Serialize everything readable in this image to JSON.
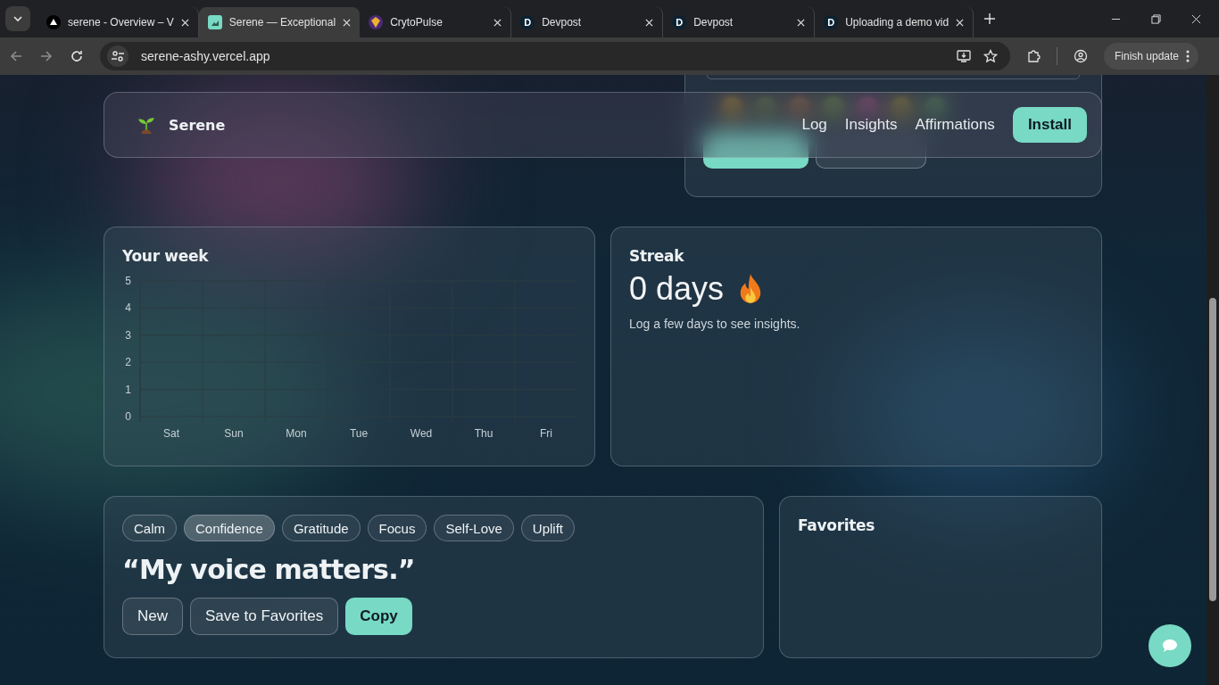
{
  "browser": {
    "tabs": [
      {
        "title": "serene - Overview – V",
        "kind": "triangle",
        "selected": false
      },
      {
        "title": "Serene — Exceptional",
        "kind": "app",
        "selected": true
      },
      {
        "title": "CrytoPulse",
        "kind": "gem",
        "selected": false
      },
      {
        "title": "Devpost",
        "kind": "letter",
        "icon_text": "D",
        "selected": false
      },
      {
        "title": "Devpost",
        "kind": "letter",
        "icon_text": "D",
        "selected": false
      },
      {
        "title": "Uploading a demo vid",
        "kind": "letter",
        "icon_text": "D",
        "selected": false
      }
    ],
    "address": "serene-ashy.vercel.app",
    "update_button": "Finish update"
  },
  "navbar": {
    "brand": "Serene",
    "links": [
      "Log",
      "Insights",
      "Affirmations"
    ],
    "install": "Install"
  },
  "week": {
    "title": "Your week",
    "chart_data": {
      "type": "bar",
      "categories": [
        "Sat",
        "Sun",
        "Mon",
        "Tue",
        "Wed",
        "Thu",
        "Fri"
      ],
      "values": [
        null,
        null,
        null,
        null,
        null,
        null,
        null
      ],
      "ylim": [
        0,
        5
      ],
      "grid": true,
      "yticks": [
        0,
        1,
        2,
        3,
        4,
        5
      ]
    }
  },
  "streak": {
    "title": "Streak",
    "value": "0 days",
    "note": "Log a few days to see insights."
  },
  "affirmations": {
    "categories": [
      {
        "label": "Calm",
        "selected": false
      },
      {
        "label": "Confidence",
        "selected": true
      },
      {
        "label": "Gratitude",
        "selected": false
      },
      {
        "label": "Focus",
        "selected": false
      },
      {
        "label": "Self-Love",
        "selected": false
      },
      {
        "label": "Uplift",
        "selected": false
      }
    ],
    "quote": "“My voice matters.”",
    "buttons": [
      {
        "label": "New",
        "kind": "secondary"
      },
      {
        "label": "Save to Favorites",
        "kind": "secondary"
      },
      {
        "label": "Copy",
        "kind": "primary"
      }
    ]
  },
  "favorites": {
    "title": "Favorites"
  }
}
